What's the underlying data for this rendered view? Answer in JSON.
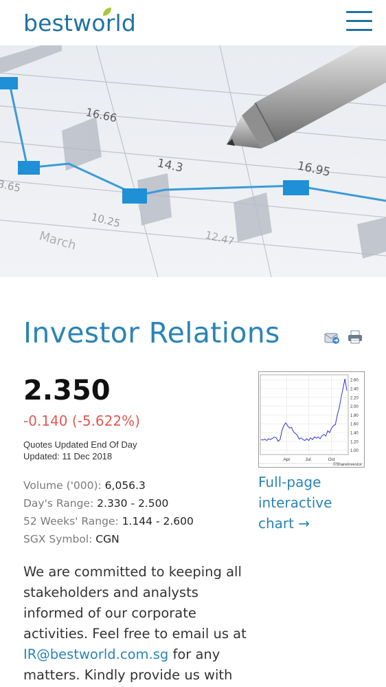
{
  "header": {
    "logo_text": "bestworld",
    "brand_color": "#1e72a3"
  },
  "hero": {
    "labels": [
      "16.66",
      "14.3",
      "16.95",
      "10.25",
      "12.47",
      "March",
      "3.65"
    ]
  },
  "main": {
    "title": "Investor Relations",
    "tools": {
      "email_icon": "email-page-icon",
      "print_icon": "printer-icon"
    },
    "price": "2.350",
    "change": "-0.140 (-5.622%)",
    "quotes_note": "Quotes Updated End Of Day",
    "updated": "Updated: 11 Dec 2018",
    "stats": [
      {
        "label": "Volume ('000): ",
        "value": "6,056.3"
      },
      {
        "label": "Day's Range: ",
        "value": "2.330 - 2.500"
      },
      {
        "label": "52 Weeks' Range: ",
        "value": "1.144 - 2.600"
      },
      {
        "label": "SGX Symbol: ",
        "value": "CGN"
      }
    ],
    "full_chart_link": "Full-page interactive chart →",
    "paragraph_before": "We are committed to keeping all stakeholders and analysts informed of our corporate activities. Feel free to email us at ",
    "email_link": "IR@bestworld.com.sg",
    "paragraph_after": " for any matters. Kindly provide us with"
  },
  "chart_data": {
    "type": "line",
    "x_ticks": [
      "Apr",
      "Jul",
      "Oct"
    ],
    "y_ticks": [
      "2.60",
      "2.40",
      "2.20",
      "2.00",
      "1.80",
      "1.60",
      "1.40",
      "1.20",
      "1.00"
    ],
    "ylim": [
      0.9,
      2.65
    ],
    "credit": "©ShareInvestor",
    "series": [
      {
        "values": [
          1.24,
          1.23,
          1.25,
          1.22,
          1.26,
          1.24,
          1.27,
          1.3,
          1.28,
          1.2,
          1.24,
          1.45,
          1.56,
          1.62,
          1.55,
          1.5,
          1.52,
          1.42,
          1.38,
          1.34,
          1.25,
          1.28,
          1.24,
          1.22,
          1.26,
          1.22,
          1.28,
          1.24,
          1.3,
          1.27,
          1.3,
          1.26,
          1.33,
          1.36,
          1.32,
          1.44,
          1.4,
          1.5,
          1.56,
          1.58,
          1.8,
          1.96,
          2.2,
          2.4,
          2.62,
          2.35
        ]
      }
    ]
  }
}
